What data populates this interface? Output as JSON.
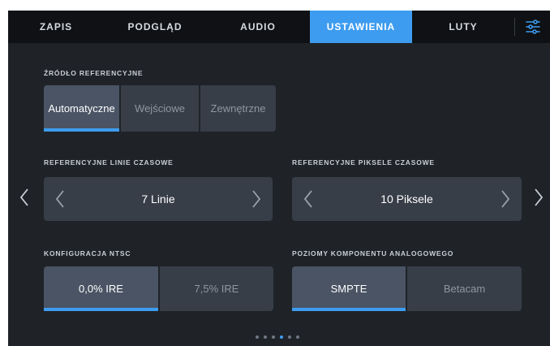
{
  "tabs": [
    {
      "label": "ZAPIS"
    },
    {
      "label": "PODGLĄD"
    },
    {
      "label": "AUDIO"
    },
    {
      "label": "USTAWIENIA"
    },
    {
      "label": "LUTY"
    }
  ],
  "active_tab": "USTAWIENIA",
  "reference_source": {
    "label": "ŹRÓDŁO REFERENCYJNE",
    "options": [
      "Automatyczne",
      "Wejściowe",
      "Zewnętrzne"
    ],
    "selected": "Automatyczne"
  },
  "ref_lines": {
    "label": "REFERENCYJNE LINIE CZASOWE",
    "value": "7 Linie"
  },
  "ref_pixels": {
    "label": "REFERENCYJNE PIKSELE CZASOWE",
    "value": "10 Piksele"
  },
  "ntsc": {
    "label": "KONFIGURACJA NTSC",
    "options": [
      "0,0% IRE",
      "7,5% IRE"
    ],
    "selected": "0,0% IRE"
  },
  "analog": {
    "label": "POZIOMY KOMPONENTU ANALOGOWEGO",
    "options": [
      "SMPTE",
      "Betacam"
    ],
    "selected": "SMPTE"
  },
  "pagination": {
    "pages": 6,
    "current": 4
  },
  "colors": {
    "accent": "#3d9cf0",
    "background": "#1f2328",
    "button": "#373e48",
    "tabbar": "#0f1114"
  },
  "icons": [
    "sliders-icon",
    "chevron-left-icon",
    "chevron-right-icon"
  ]
}
